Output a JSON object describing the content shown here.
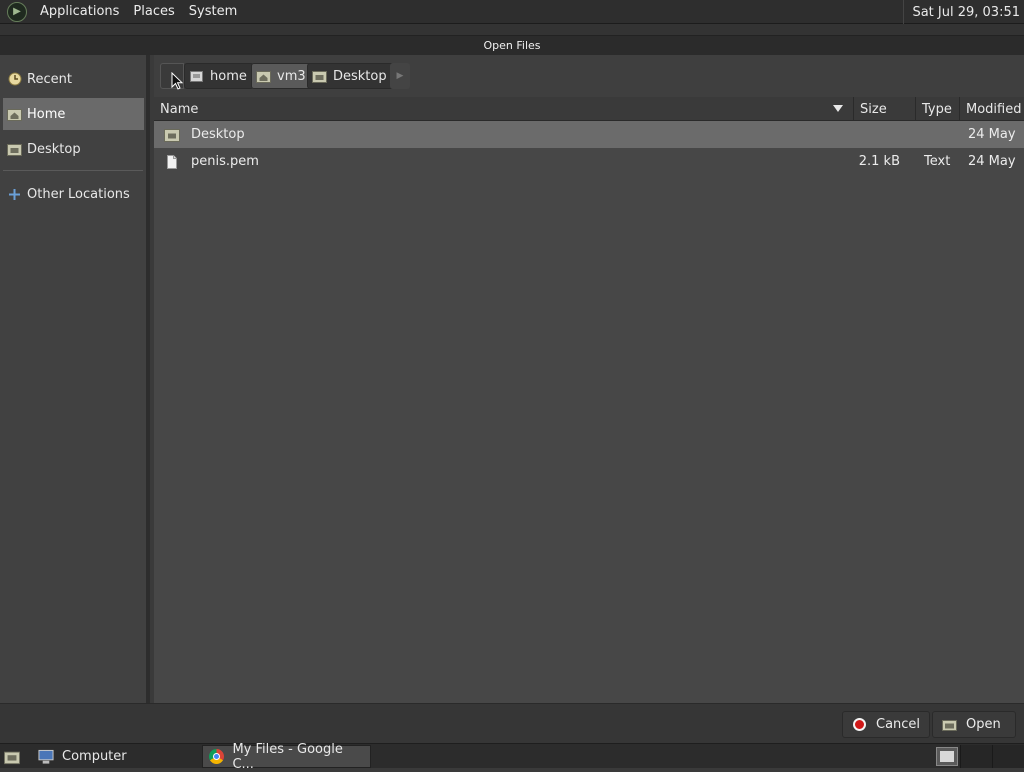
{
  "top_panel": {
    "menus": [
      "Applications",
      "Places",
      "System"
    ],
    "clock": "Sat Jul 29, 03:51"
  },
  "dialog": {
    "title": "Open Files"
  },
  "sidebar": {
    "items": [
      {
        "label": "Recent",
        "icon": "recent-icon"
      },
      {
        "label": "Home",
        "icon": "home-icon",
        "active": true
      },
      {
        "label": "Desktop",
        "icon": "desktop-folder-icon"
      },
      {
        "label": "Other Locations",
        "icon": "plus-icon"
      }
    ]
  },
  "pathbar": {
    "crumbs": [
      "home",
      "vm3",
      "Desktop"
    ]
  },
  "filelist": {
    "columns": [
      "Name",
      "Size",
      "Type",
      "Modified"
    ],
    "rows": [
      {
        "name": "Desktop",
        "size": "",
        "type": "",
        "modified": "24 May",
        "icon": "folder-icon",
        "selected": true
      },
      {
        "name": "penis.pem",
        "size": "2.1 kB",
        "type": "Text",
        "modified": "24 May",
        "icon": "file-icon"
      }
    ]
  },
  "buttons": {
    "cancel": "Cancel",
    "open": "Open"
  },
  "taskbar": {
    "computer": "Computer",
    "window": "My Files - Google C..."
  }
}
